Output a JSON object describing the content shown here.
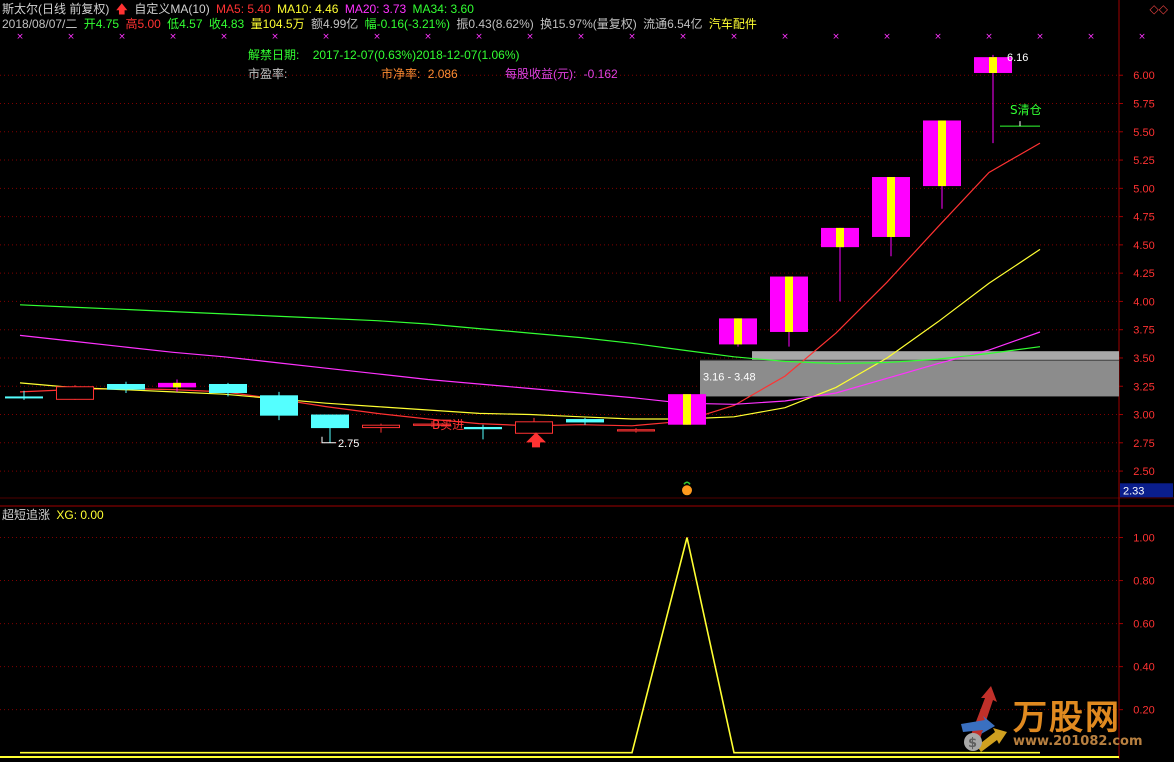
{
  "header": {
    "title": "斯太尔(日线 前复权)",
    "indicator": "自定义MA(10)",
    "ma5": "MA5: 5.40",
    "ma10": "MA10: 4.46",
    "ma20": "MA20: 3.73",
    "ma34": "MA34: 3.60",
    "date": "2018/08/07/二",
    "open": "开4.75",
    "high": "高5.00",
    "low": "低4.57",
    "close": "收4.83",
    "volume": "量104.5万",
    "amount": "额4.99亿",
    "change": "幅-0.16(-3.21%)",
    "amplitude": "振0.43(8.62%)",
    "turnover": "换15.97%(量复权)",
    "float": "流通6.54亿",
    "sector": "汽车配件",
    "corner": "◇◇"
  },
  "fundamentals": {
    "unlock_label": "解禁日期:",
    "unlock_value": "2017-12-07(0.63%)2018-12-07(1.06%)",
    "pe_label": "市盈率:",
    "pb_label": "市净率:",
    "pb_value": "2.086",
    "eps_label": "每股收益(元):",
    "eps_value": "-0.162"
  },
  "colors": {
    "up": "#ff3232",
    "down": "#54ffff",
    "signal": "#ff00ff",
    "signal_body": "#ffff00",
    "ma5": "#ff3232",
    "ma10": "#ffff32",
    "ma20": "#ff32ff",
    "ma34": "#32ff32",
    "grid": "#800000",
    "axis_text": "#ff3232",
    "zone": "#8c8c8c"
  },
  "chart_data": [
    {
      "type": "candlestick",
      "title": "斯太尔(日线 前复权)",
      "yticks": [
        2.5,
        2.75,
        3.0,
        3.25,
        3.5,
        3.75,
        4.0,
        4.25,
        4.5,
        4.75,
        5.0,
        5.25,
        5.5,
        5.75,
        6.0
      ],
      "ylim": [
        2.2,
        6.4
      ],
      "price_tag": "2.33",
      "candles": [
        {
          "o": 3.16,
          "h": 3.21,
          "l": 3.13,
          "c": 3.16,
          "kind": "down"
        },
        {
          "o": 3.13,
          "h": 3.26,
          "l": 3.13,
          "c": 3.25,
          "kind": "up"
        },
        {
          "o": 3.27,
          "h": 3.29,
          "l": 3.19,
          "c": 3.22,
          "kind": "down"
        },
        {
          "o": 3.24,
          "h": 3.31,
          "l": 3.2,
          "c": 3.28,
          "kind": "signal"
        },
        {
          "o": 3.27,
          "h": 3.28,
          "l": 3.16,
          "c": 3.19,
          "kind": "down"
        },
        {
          "o": 3.17,
          "h": 3.2,
          "l": 2.95,
          "c": 2.99,
          "kind": "down"
        },
        {
          "o": 3.0,
          "h": 3.0,
          "l": 2.75,
          "c": 2.88,
          "kind": "down"
        },
        {
          "o": 2.88,
          "h": 2.92,
          "l": 2.84,
          "c": 2.91,
          "kind": "up"
        },
        {
          "o": 2.9,
          "h": 2.94,
          "l": 2.89,
          "c": 2.92,
          "kind": "up"
        },
        {
          "o": 2.89,
          "h": 2.91,
          "l": 2.78,
          "c": 2.87,
          "kind": "down"
        },
        {
          "o": 2.83,
          "h": 2.97,
          "l": 2.83,
          "c": 2.94,
          "kind": "up"
        },
        {
          "o": 2.96,
          "h": 2.97,
          "l": 2.91,
          "c": 2.93,
          "kind": "down"
        },
        {
          "o": 2.85,
          "h": 2.88,
          "l": 2.84,
          "c": 2.87,
          "kind": "up"
        },
        {
          "o": 2.91,
          "h": 3.18,
          "l": 2.91,
          "c": 3.18,
          "kind": "signal"
        },
        {
          "o": 3.62,
          "h": 3.85,
          "l": 3.6,
          "c": 3.85,
          "kind": "signal"
        },
        {
          "o": 3.73,
          "h": 4.22,
          "l": 3.6,
          "c": 4.22,
          "kind": "signal"
        },
        {
          "o": 4.48,
          "h": 4.65,
          "l": 4.0,
          "c": 4.65,
          "kind": "signal"
        },
        {
          "o": 4.57,
          "h": 5.1,
          "l": 4.4,
          "c": 5.1,
          "kind": "signal"
        },
        {
          "o": 5.02,
          "h": 5.6,
          "l": 4.82,
          "c": 5.6,
          "kind": "signal"
        },
        {
          "o": 6.02,
          "h": 6.18,
          "l": 5.4,
          "c": 6.16,
          "kind": "signal"
        }
      ],
      "series": [
        {
          "name": "MA5",
          "values": [
            3.2,
            3.22,
            3.23,
            3.22,
            3.2,
            3.14,
            3.07,
            3.01,
            2.96,
            2.92,
            2.9,
            2.91,
            2.9,
            2.94,
            3.08,
            3.34,
            3.72,
            4.17,
            4.66,
            5.14,
            5.4
          ]
        },
        {
          "name": "MA10",
          "values": [
            3.28,
            3.24,
            3.22,
            3.2,
            3.18,
            3.14,
            3.1,
            3.07,
            3.04,
            3.01,
            3.0,
            2.98,
            2.96,
            2.96,
            2.98,
            3.06,
            3.24,
            3.5,
            3.82,
            4.16,
            4.46
          ]
        },
        {
          "name": "MA20",
          "values": [
            3.7,
            3.65,
            3.6,
            3.55,
            3.51,
            3.46,
            3.41,
            3.36,
            3.31,
            3.27,
            3.23,
            3.19,
            3.15,
            3.1,
            3.09,
            3.12,
            3.19,
            3.32,
            3.45,
            3.57,
            3.73
          ]
        },
        {
          "name": "MA34",
          "values": [
            3.97,
            3.95,
            3.93,
            3.91,
            3.89,
            3.87,
            3.85,
            3.83,
            3.8,
            3.76,
            3.72,
            3.68,
            3.63,
            3.57,
            3.51,
            3.47,
            3.45,
            3.46,
            3.49,
            3.54,
            3.6
          ]
        }
      ],
      "zone": {
        "from": 3.16,
        "to": 3.48,
        "label": "3.16 - 3.48"
      },
      "annotations": [
        {
          "text": "2.75",
          "index": 6,
          "price": 2.75
        },
        {
          "text": "B买进",
          "index": 10,
          "price": 2.94
        },
        {
          "text": "6.16",
          "index": 19,
          "price": 6.16
        },
        {
          "text": "S清仓",
          "index": 20,
          "price": 5.55
        }
      ]
    },
    {
      "type": "line",
      "title": "超短追涨",
      "label": "XG: 0.00",
      "yticks": [
        0.2,
        0.4,
        0.6,
        0.8,
        1.0
      ],
      "ylim": [
        -0.02,
        1.1
      ],
      "x": [
        0,
        1,
        2,
        3,
        4,
        5,
        6,
        7,
        8,
        9,
        10,
        11,
        12,
        13,
        14,
        15,
        16,
        17,
        18,
        19,
        20
      ],
      "values": [
        0,
        0,
        0,
        0,
        0,
        0,
        0,
        0,
        0,
        0,
        0,
        0,
        0,
        1,
        0,
        0,
        0,
        0,
        0,
        0,
        0
      ]
    }
  ],
  "watermark": {
    "brand": "万股网",
    "url": "www.201082.com"
  }
}
